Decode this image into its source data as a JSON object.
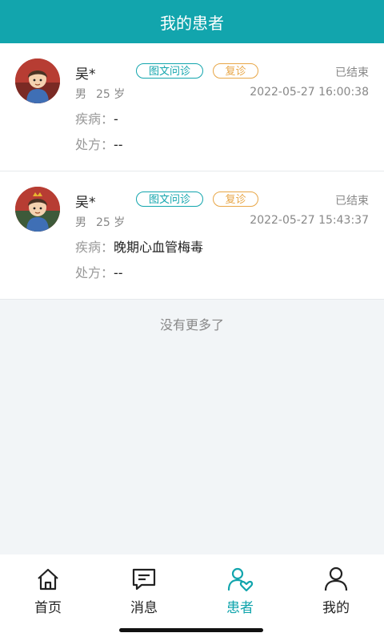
{
  "header": {
    "title": "我的患者"
  },
  "patients": [
    {
      "name": "吴*",
      "consult_type": "图文问诊",
      "visit_type": "复诊",
      "status": "已结束",
      "gender": "男",
      "age": "25 岁",
      "datetime": "2022-05-27 16:00:38",
      "disease_label": "疾病：",
      "disease": "-",
      "rx_label": "处方：",
      "rx": "--"
    },
    {
      "name": "吴*",
      "consult_type": "图文问诊",
      "visit_type": "复诊",
      "status": "已结束",
      "gender": "男",
      "age": "25 岁",
      "datetime": "2022-05-27 15:43:37",
      "disease_label": "疾病：",
      "disease": "晚期心血管梅毒",
      "rx_label": "处方：",
      "rx": "--"
    }
  ],
  "list_end_text": "没有更多了",
  "tabbar": {
    "active": "patients",
    "items": [
      {
        "key": "home",
        "label": "首页",
        "icon": "home-icon"
      },
      {
        "key": "messages",
        "label": "消息",
        "icon": "message-icon"
      },
      {
        "key": "patients",
        "label": "患者",
        "icon": "patients-icon"
      },
      {
        "key": "mine",
        "label": "我的",
        "icon": "user-icon"
      }
    ]
  },
  "colors": {
    "primary": "#12a5ad",
    "visit_tag": "#e8a646",
    "page_bg": "#f2f5f7"
  }
}
